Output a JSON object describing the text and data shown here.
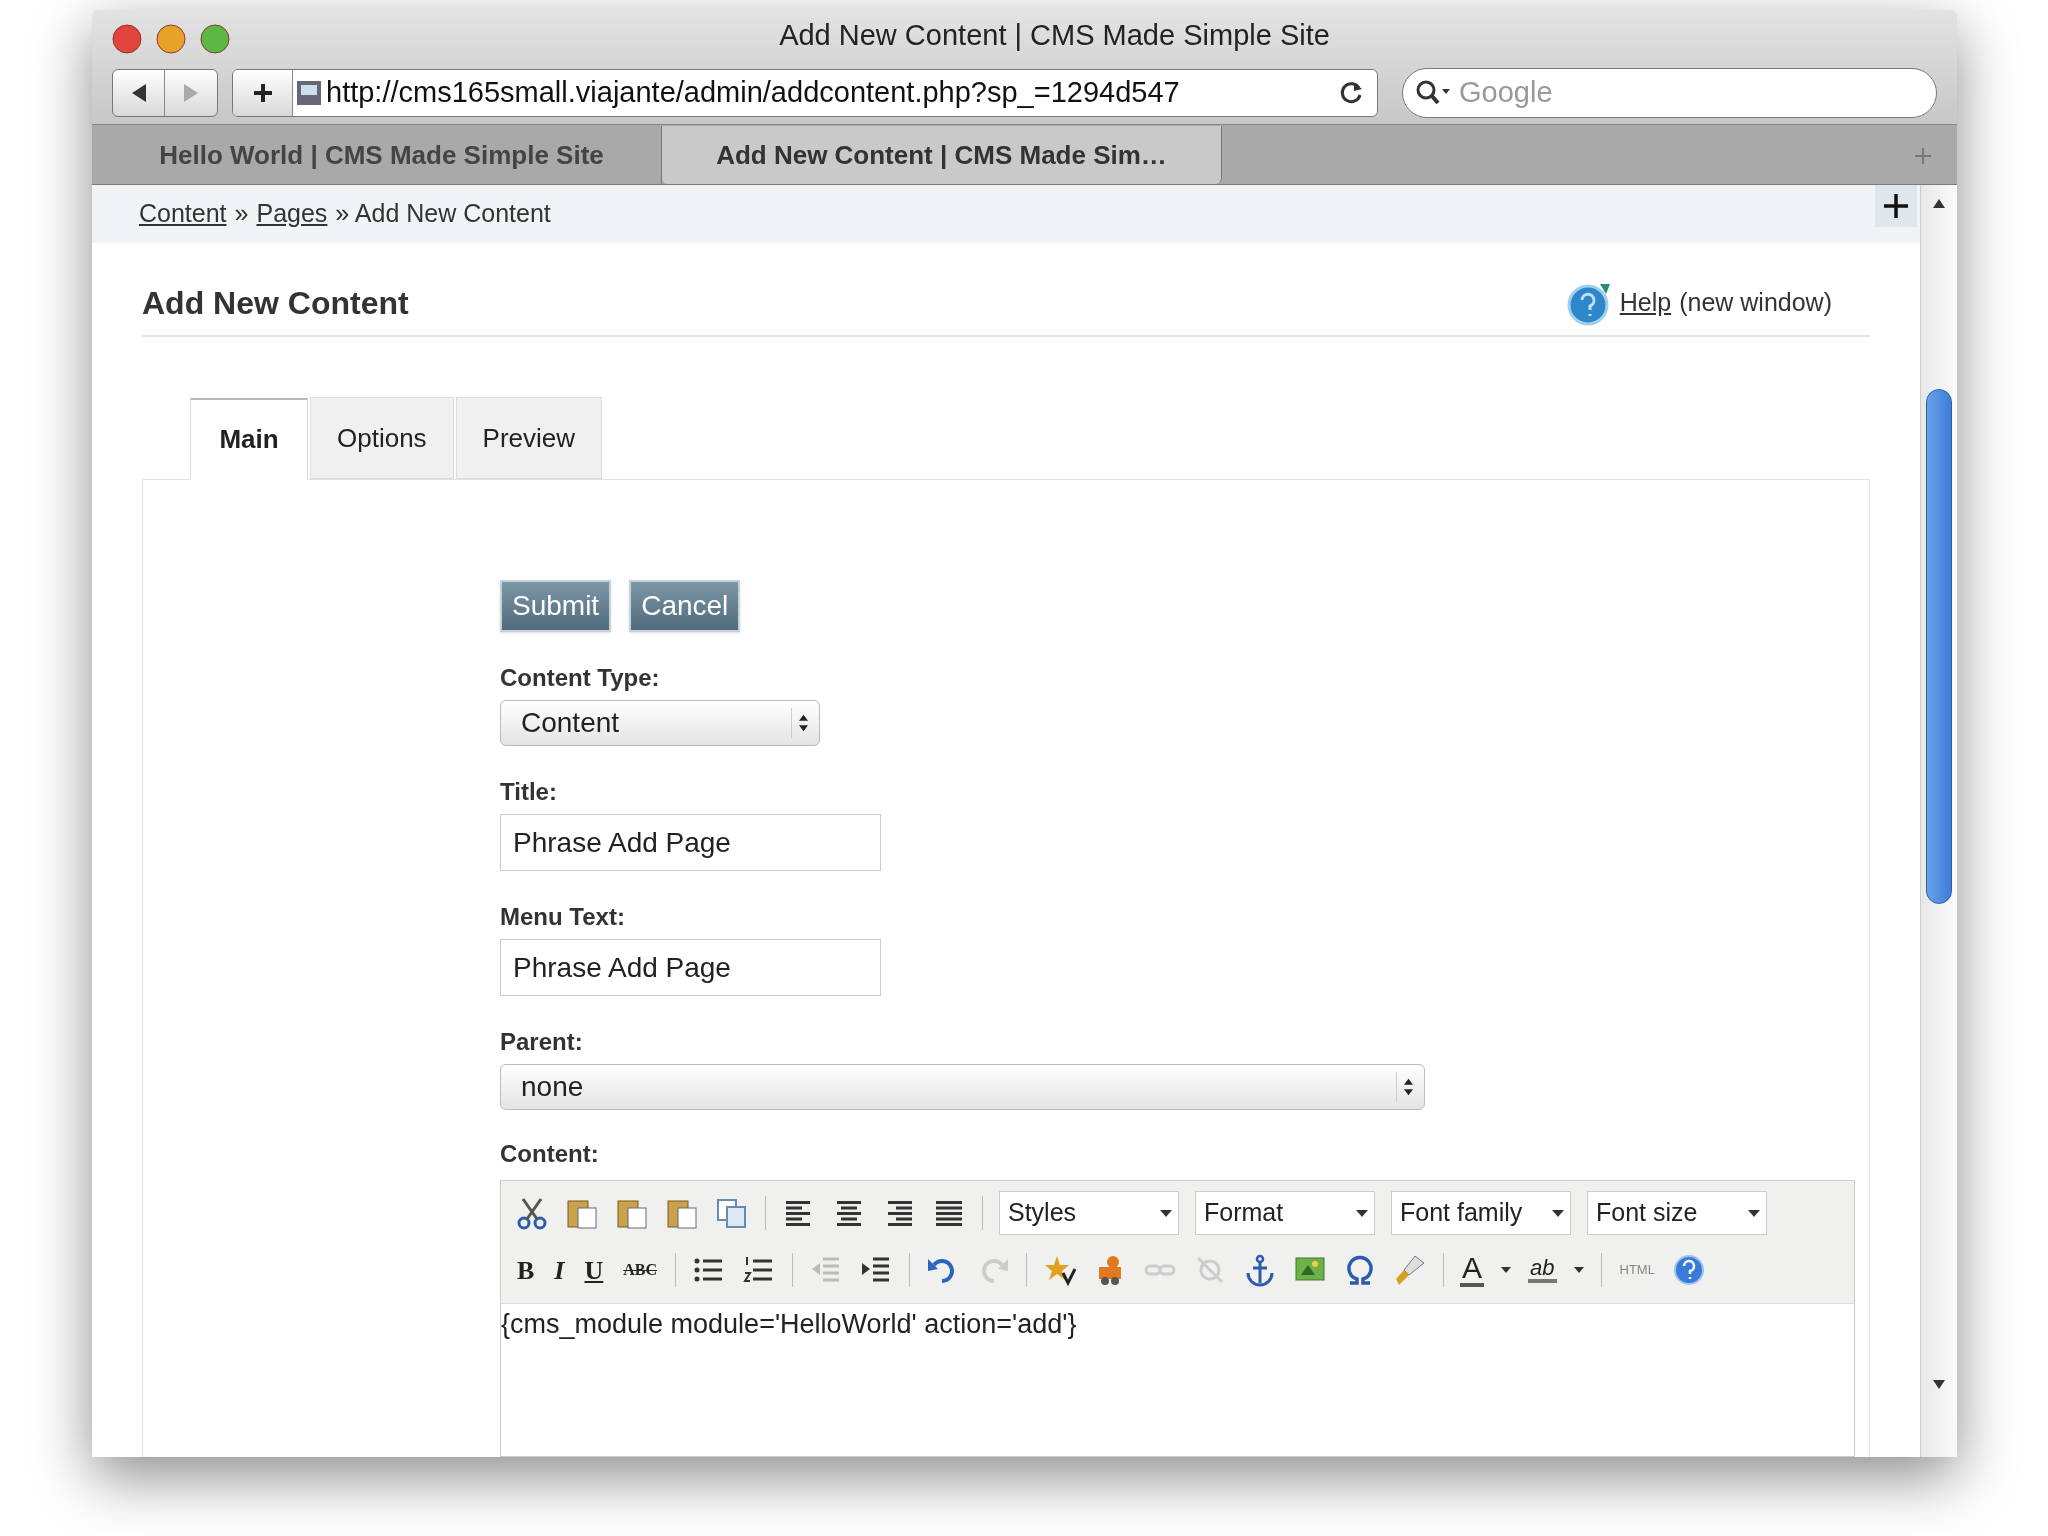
{
  "window": {
    "title": "Add New Content | CMS Made Simple Site"
  },
  "address_bar": {
    "url": "http://cms165small.viajante/admin/addcontent.php?sp_=1294d547"
  },
  "search": {
    "placeholder": "Google"
  },
  "browser_tabs": [
    {
      "label": "Hello World | CMS Made Simple Site",
      "selected": false
    },
    {
      "label": "Add New Content | CMS Made Sim…",
      "selected": true
    }
  ],
  "breadcrumb": [
    {
      "label": "Content",
      "link": true
    },
    {
      "label": "»",
      "link": false
    },
    {
      "label": "Pages",
      "link": true
    },
    {
      "label": "» Add New Content",
      "link": false
    }
  ],
  "heading": "Add New Content",
  "help": {
    "link": "Help",
    "note": "(new window)"
  },
  "tabs": [
    {
      "label": "Main",
      "selected": true
    },
    {
      "label": "Options",
      "selected": false
    },
    {
      "label": "Preview",
      "selected": false
    }
  ],
  "buttons": [
    "Submit",
    "Cancel"
  ],
  "fields": [
    {
      "kind": "select",
      "label": "Content Type:",
      "value": "Content",
      "wide": false
    },
    {
      "kind": "text",
      "label": "Title:",
      "value": "Phrase Add Page"
    },
    {
      "kind": "text",
      "label": "Menu Text:",
      "value": "Phrase Add Page"
    },
    {
      "kind": "select",
      "label": "Parent:",
      "value": "none",
      "wide": true
    }
  ],
  "editor": {
    "label": "Content:",
    "dropdowns": [
      "Styles",
      "Format",
      "Font family",
      "Font size"
    ],
    "glyphs": [
      "B",
      "I",
      "U",
      "ABC",
      "A",
      "ab",
      "HTML"
    ],
    "text": "{cms_module module='HelloWorld' action='add'}"
  }
}
